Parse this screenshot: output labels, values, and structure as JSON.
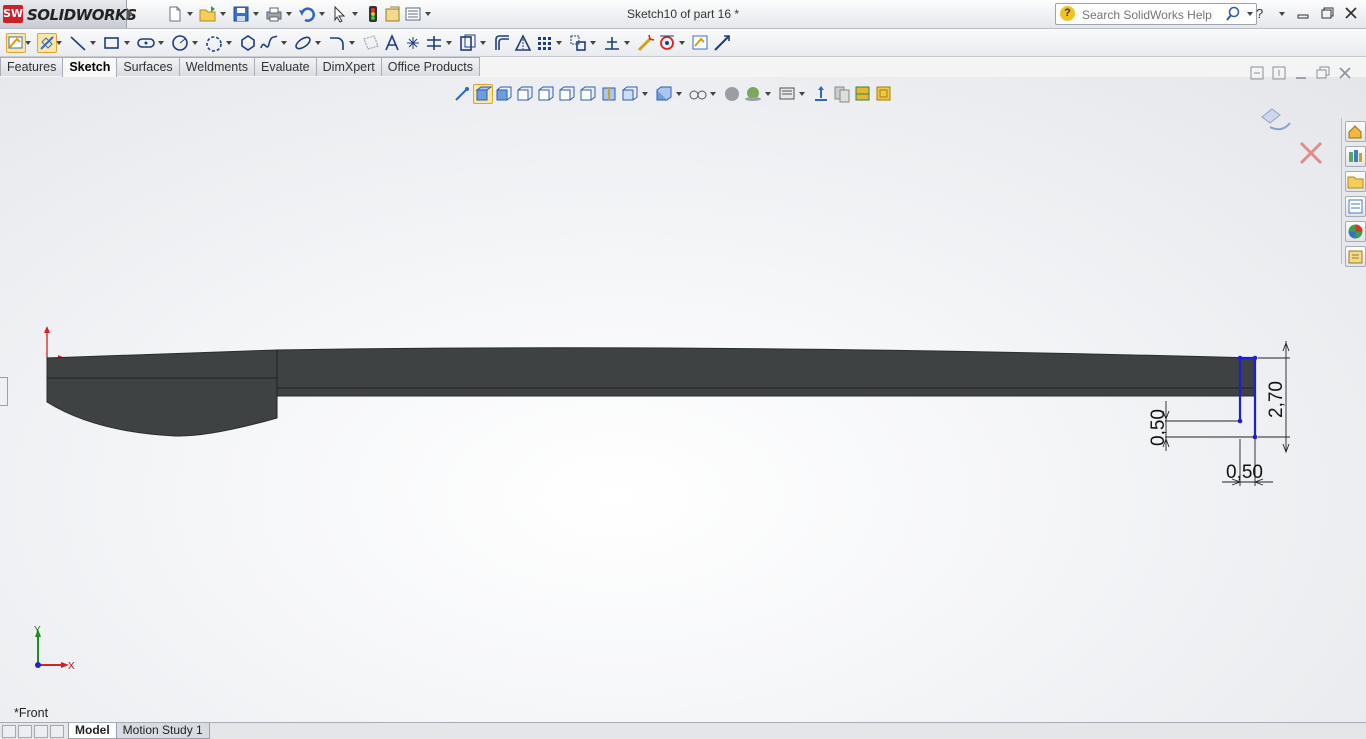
{
  "app": {
    "logo_badge": "SW",
    "name": "SOLIDWORKS",
    "document_title": "Sketch10 of part 16 *"
  },
  "search": {
    "placeholder": "Search SolidWorks Help"
  },
  "tabs": [
    "Features",
    "Sketch",
    "Surfaces",
    "Weldments",
    "Evaluate",
    "DimXpert",
    "Office Products"
  ],
  "selected_tab": "Sketch",
  "viewport": {
    "view_name": "*Front",
    "triad": {
      "y_label": "Y",
      "x_label": "X"
    },
    "dimensions": [
      {
        "id": "dim-height",
        "value": "2,70"
      },
      {
        "id": "dim-left-offset",
        "value": "0,50"
      },
      {
        "id": "dim-bottom-width",
        "value": "0,50"
      }
    ]
  },
  "bottom_tabs": [
    "Model",
    "Motion Study 1"
  ],
  "colors": {
    "accent": "#c9222b",
    "part_fill": "#404444",
    "sketch_line": "#1d1ddd",
    "bg": "#f4f4f4"
  },
  "icons": [
    "new-document-icon",
    "open-icon",
    "save-icon",
    "print-icon",
    "undo-icon",
    "select-icon",
    "rebuild-icon",
    "options-icon",
    "help-icon",
    "search-icon",
    "minimize-icon",
    "restore-icon",
    "close-icon"
  ]
}
